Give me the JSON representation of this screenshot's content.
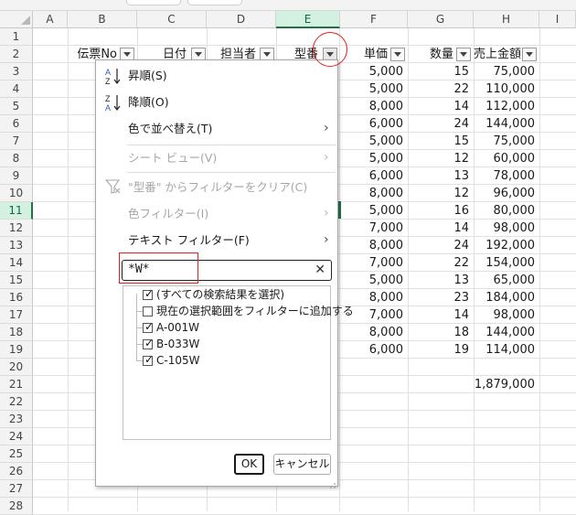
{
  "columns": [
    "A",
    "B",
    "C",
    "D",
    "E",
    "F",
    "G",
    "H",
    "I"
  ],
  "selected_column": "E",
  "rows": [
    "1",
    "2",
    "3",
    "4",
    "5",
    "6",
    "7",
    "8",
    "9",
    "10",
    "11",
    "12",
    "13",
    "14",
    "15",
    "16",
    "17",
    "18",
    "19",
    "20",
    "21",
    "22",
    "23",
    "24",
    "25",
    "26",
    "27",
    "28"
  ],
  "selected_row": "11",
  "headers": {
    "b": "伝票No",
    "c": "日付",
    "d": "担当者",
    "e": "型番",
    "f": "単価",
    "g": "数量",
    "h": "売上金額"
  },
  "data_rows": [
    {
      "f": "5,000",
      "g": "15",
      "h": "75,000"
    },
    {
      "f": "5,000",
      "g": "22",
      "h": "110,000"
    },
    {
      "f": "8,000",
      "g": "14",
      "h": "112,000"
    },
    {
      "f": "6,000",
      "g": "24",
      "h": "144,000"
    },
    {
      "f": "5,000",
      "g": "15",
      "h": "75,000"
    },
    {
      "f": "5,000",
      "g": "12",
      "h": "60,000"
    },
    {
      "f": "6,000",
      "g": "13",
      "h": "78,000"
    },
    {
      "f": "8,000",
      "g": "12",
      "h": "96,000"
    },
    {
      "f": "5,000",
      "g": "16",
      "h": "80,000"
    },
    {
      "f": "7,000",
      "g": "14",
      "h": "98,000"
    },
    {
      "f": "8,000",
      "g": "24",
      "h": "192,000"
    },
    {
      "f": "7,000",
      "g": "22",
      "h": "154,000"
    },
    {
      "f": "5,000",
      "g": "13",
      "h": "65,000"
    },
    {
      "f": "8,000",
      "g": "23",
      "h": "184,000"
    },
    {
      "f": "7,000",
      "g": "14",
      "h": "98,000"
    },
    {
      "f": "8,000",
      "g": "18",
      "h": "144,000"
    },
    {
      "f": "6,000",
      "g": "19",
      "h": "114,000"
    }
  ],
  "total": "1,879,000",
  "menu": {
    "sort_asc": "昇順(S)",
    "sort_desc": "降順(O)",
    "sort_by_color": "色で並べ替え(T)",
    "sheet_view": "シート ビュー(V)",
    "clear_filter": "\"型番\" からフィルターをクリア(C)",
    "color_filter": "色フィルター(I)",
    "text_filter": "テキスト フィルター(F)",
    "sort_asc_icon_top": "A",
    "sort_asc_icon_bottom": "Z",
    "sort_desc_icon_top": "Z",
    "sort_desc_icon_bottom": "A",
    "search_value": "*W*",
    "search_clear": "✕",
    "list": [
      {
        "label": "(すべての検索結果を選択)",
        "checked": true
      },
      {
        "label": "現在の選択範囲をフィルターに追加する",
        "checked": false
      },
      {
        "label": "A-001W",
        "checked": true
      },
      {
        "label": "B-033W",
        "checked": true
      },
      {
        "label": "C-105W",
        "checked": true
      }
    ],
    "ok": "OK",
    "cancel": "キャンセル"
  },
  "colors": {
    "accent_green": "#217346",
    "annotation_red": "#e02020"
  }
}
